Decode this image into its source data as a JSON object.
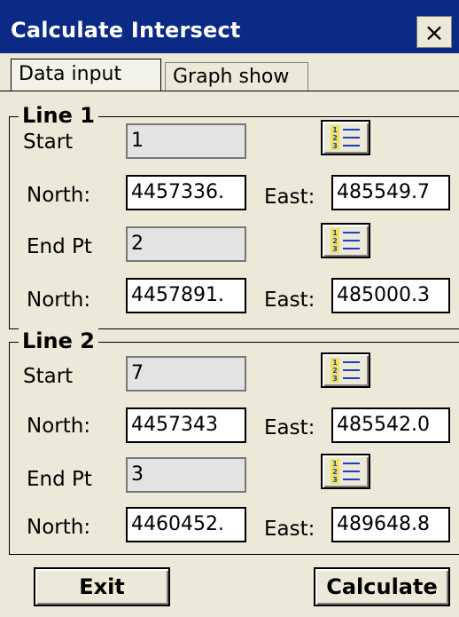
{
  "window": {
    "title": "Calculate Intersect",
    "close_label": "×"
  },
  "tabs": [
    {
      "label": "Data input"
    },
    {
      "label": "Graph show"
    }
  ],
  "line1": {
    "group_label": "Line 1",
    "start_label": "Start",
    "start_value": "1",
    "north_label": "North:",
    "north_value": "4457336.",
    "east_label": "East:",
    "east_value": "485549.7",
    "end_label": "End Pt",
    "end_value": "2",
    "north2_label": "North:",
    "north2_value": "4457891.",
    "east2_label": "East:",
    "east2_value": "485000.3"
  },
  "line2": {
    "group_label": "Line 2",
    "start_label": "Start",
    "start_value": "7",
    "north_label": "North:",
    "north_value": "4457343",
    "east_label": "East:",
    "east_value": "485542.0",
    "end_label": "End Pt",
    "end_value": "3",
    "north2_label": "North:",
    "north2_value": "4460452.",
    "east2_label": "East:",
    "east2_value": "489648.8"
  },
  "buttons": {
    "exit_label": "Exit",
    "calculate_label": "Calculate"
  },
  "colors": {
    "titlebar": "#0a2a86",
    "window_bg": "#ece9d8",
    "icon_blue": "#1c3fbf",
    "icon_yellow": "#f2e15a"
  },
  "icons": {
    "point_list": "numbered-list-icon",
    "close": "close-icon"
  }
}
